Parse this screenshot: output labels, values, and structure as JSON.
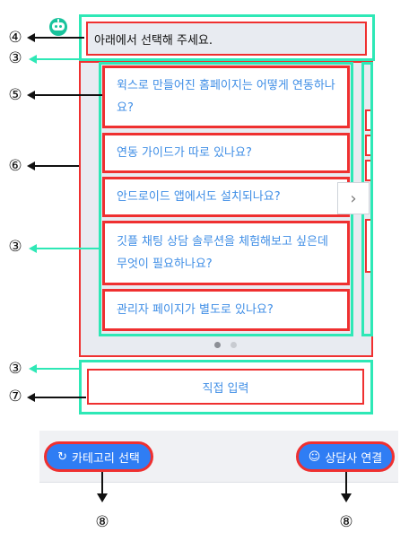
{
  "callouts": [
    "④",
    "③",
    "⑤",
    "⑥",
    "③",
    "③",
    "⑦",
    "⑧",
    "⑧"
  ],
  "message": {
    "text": "아래에서 선택해 주세요."
  },
  "questions": [
    {
      "text": "윅스로 만들어진 홈페이지는 어떻게 연동하나요?"
    },
    {
      "text": "연동 가이드가 따로 있나요?"
    },
    {
      "text": "안드로이드 앱에서도 설치되나요?"
    },
    {
      "text": "깃플 채팅 상담 솔루션을 체험해보고 싶은데 무엇이 필요하나요?"
    },
    {
      "text": "관리자 페이지가 별도로 있나요?"
    }
  ],
  "carousel": {
    "next_icon": "chevron-right-icon",
    "pages": 2,
    "current_page": 1
  },
  "direct_input": {
    "label": "직접 입력"
  },
  "bottom": {
    "category": {
      "label": "카테고리 선택",
      "icon": "refresh-icon"
    },
    "agent": {
      "label": "상담사 연결",
      "icon": "smile-icon"
    }
  },
  "colors": {
    "annotation_box": "#ef3030",
    "annotation_group": "#2ee8b6",
    "link_text": "#3f8ee6",
    "pill_bg": "#2f7df4",
    "panel_bg": "#e8ebf1",
    "bot": "#19c39c"
  }
}
